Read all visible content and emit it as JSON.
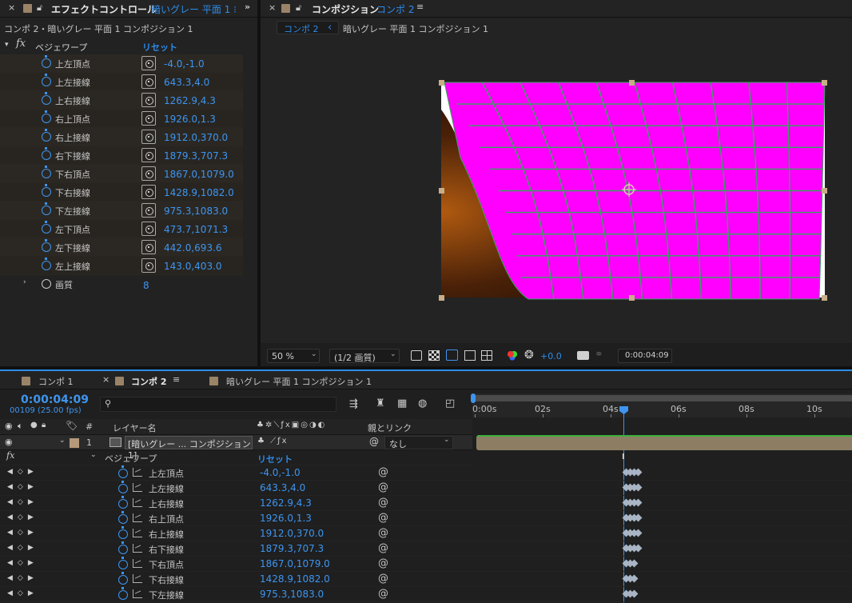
{
  "colors": {
    "accent": "#2d8ceb",
    "value": "#3d95f0",
    "layer_magenta": "#ff00ff",
    "grid_line": "#33a65a"
  },
  "ec_panel": {
    "close": "×",
    "title": "エフェクトコントロール",
    "title_layer": "暗いグレー 平面 1 ⁝",
    "menu_icon": "≡",
    "breadcrumb": "コンポ 2・暗いグレー 平面 1 コンポジション 1",
    "effect_name": "ベジェワープ",
    "reset": "リセット",
    "fx": "fx",
    "props": [
      {
        "label": "上左頂点",
        "value": "-4.0,-1.0"
      },
      {
        "label": "上左接線",
        "value": "643.3,4.0"
      },
      {
        "label": "上右接線",
        "value": "1262.9,4.3"
      },
      {
        "label": "右上頂点",
        "value": "1926.0,1.3"
      },
      {
        "label": "右上接線",
        "value": "1912.0,370.0"
      },
      {
        "label": "右下接線",
        "value": "1879.3,707.3"
      },
      {
        "label": "下右頂点",
        "value": "1867.0,1079.0"
      },
      {
        "label": "下右接線",
        "value": "1428.9,1082.0"
      },
      {
        "label": "下左接線",
        "value": "975.3,1083.0"
      },
      {
        "label": "左下頂点",
        "value": "473.7,1071.3"
      },
      {
        "label": "左下接線",
        "value": "442.0,693.6"
      },
      {
        "label": "左上接線",
        "value": "143.0,403.0"
      }
    ],
    "quality": {
      "label": "画質",
      "value": "8"
    }
  },
  "comp_panel": {
    "close": "×",
    "title": "コンポジション",
    "title_comp": "コンポ 2",
    "menu_icon": "≡",
    "crumb_active": "コンポ 2",
    "crumb_arrow": "‹",
    "crumb_next": "暗いグレー 平面 1 コンポジション 1",
    "zoom": "50 %",
    "resolution": "(1/2 画質)",
    "exposure": "+0.0",
    "timecode": "0:00:04:09"
  },
  "timeline": {
    "tabs": [
      {
        "label": "コンポ 1",
        "close": ""
      },
      {
        "label": "コンポ 2",
        "close": "×",
        "menu": "≡"
      },
      {
        "label": "暗いグレー 平面 1 コンポジション 1",
        "close": ""
      }
    ],
    "timecode": "0:00:04:09",
    "frame_info": "00109 (25.00 fps)",
    "search_placeholder": "",
    "headers": {
      "num": "#",
      "layer_name": "レイヤー名",
      "parent": "親とリンク"
    },
    "layer": {
      "num": "1",
      "name": "[暗いグレー ... コンポジション 1]",
      "parent": "なし"
    },
    "effect_name": "ベジェワープ",
    "reset": "リセット",
    "ruler": [
      "0:00s",
      "02s",
      "04s",
      "06s",
      "08s",
      "10s"
    ],
    "playhead_time_seconds": 4.36,
    "props": [
      {
        "label": "上左頂点",
        "value": "-4.0,-1.0"
      },
      {
        "label": "上左接線",
        "value": "643.3,4.0"
      },
      {
        "label": "上右接線",
        "value": "1262.9,4.3"
      },
      {
        "label": "右上頂点",
        "value": "1926.0,1.3"
      },
      {
        "label": "右上接線",
        "value": "1912.0,370.0"
      },
      {
        "label": "右下接線",
        "value": "1879.3,707.3"
      },
      {
        "label": "下右頂点",
        "value": "1867.0,1079.0"
      },
      {
        "label": "下右接線",
        "value": "1428.9,1082.0"
      },
      {
        "label": "下左接線",
        "value": "975.3,1083.0"
      }
    ]
  }
}
